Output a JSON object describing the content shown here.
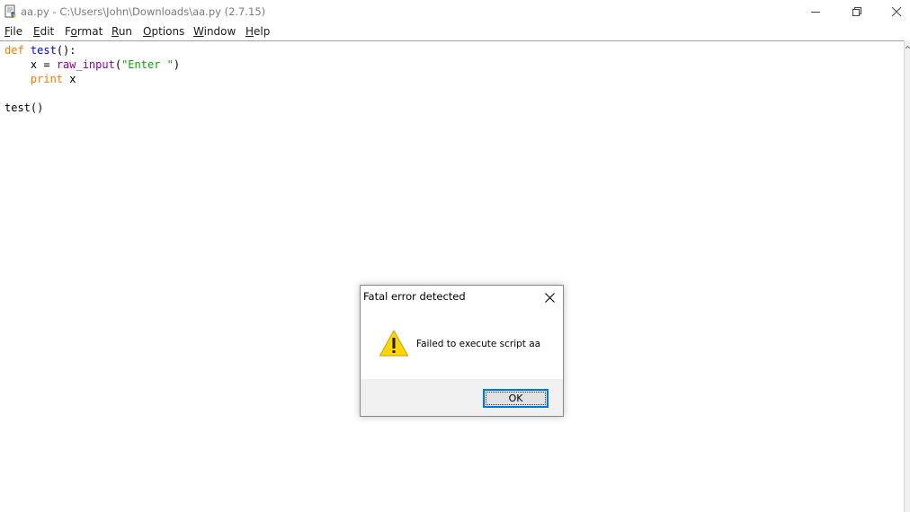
{
  "window": {
    "title": "aa.py - C:\\Users\\John\\Downloads\\aa.py (2.7.15)",
    "app_icon": "python-idle-icon",
    "controls": [
      "minimize-icon",
      "restore-icon",
      "close-icon"
    ]
  },
  "menubar": {
    "items": [
      {
        "label_first": "F",
        "label_rest": "ile"
      },
      {
        "label_first": "E",
        "label_rest": "dit"
      },
      {
        "label_first": "",
        "label_mid_u": "o",
        "label_pre": "F",
        "label_rest": "rmat"
      },
      {
        "label_first": "R",
        "label_rest": "un"
      },
      {
        "label_first": "O",
        "label_rest": "ptions"
      },
      {
        "label_first": "W",
        "label_rest": "indow"
      },
      {
        "label_first": "H",
        "label_rest": "elp"
      }
    ]
  },
  "editor": {
    "lines": [
      {
        "kw": "def",
        "sp": " ",
        "fn": "test",
        "rest": "():"
      },
      {
        "indent": "    ",
        "var": "x = ",
        "bi": "raw_input",
        "open": "(",
        "str": "\"Enter \"",
        "close": ")"
      },
      {
        "indent": "    ",
        "kw": "print",
        "rest": " x"
      },
      {
        "text": ""
      },
      {
        "text": "test()"
      }
    ]
  },
  "dialog": {
    "title": "Fatal error detected",
    "message": "Failed to execute script aa",
    "ok_label": "OK",
    "icon": "warning-icon"
  },
  "colors": {
    "keyword": "#ff7700",
    "function_def": "#0000ff",
    "builtin": "#900090",
    "string": "#00aa00",
    "dialog_focus": "#0078d7"
  }
}
